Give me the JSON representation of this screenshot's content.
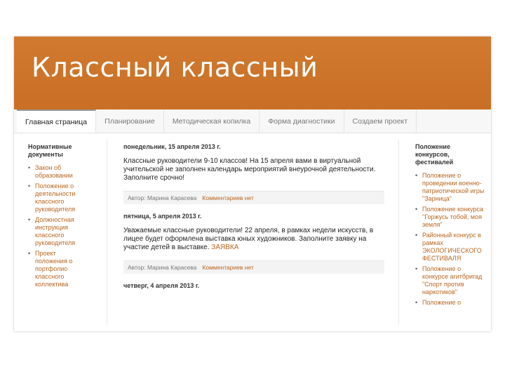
{
  "header": {
    "title": "Классный классный"
  },
  "tabs": [
    {
      "label": "Главная страница",
      "active": true
    },
    {
      "label": "Планирование"
    },
    {
      "label": "Методическая копилка"
    },
    {
      "label": "Форма диагностики"
    },
    {
      "label": "Создаем проект"
    }
  ],
  "left": {
    "heading": "Нормативные документы",
    "items": [
      "Закон об образовании",
      "Положение о деятельности классного руководителя",
      "Должностная инструкция классного руководителя",
      "Проект положения о портфолио классного коллектива"
    ]
  },
  "posts": [
    {
      "date": "понедельник, 15 апреля 2013 г.",
      "body": "Классные руководители 9-10 классов! На 15 апреля вами в виртуальной учительской не заполнен календарь мероприятий внеурочной деятельности. Заполните срочно!",
      "link": "",
      "author": "Автор: Марина Карасева",
      "comments": "Комментариев нет"
    },
    {
      "date": "пятница, 5 апреля 2013 г.",
      "body": "Уважаемые классные руководители! 22 апреля, в рамках недели искусств, в лицее будет оформлена выставка юных художников. Заполните заявку на участие детей в выставке.",
      "link": "ЗАЯВКА",
      "author": "Автор: Марина Карасева",
      "comments": "Комментариев нет"
    },
    {
      "date": "четверг, 4 апреля 2013 г."
    }
  ],
  "right": {
    "heading": "Положение конкурсов, фестивалей",
    "items": [
      "Положение о проведении военно-патриотической игры \"Зарница\"",
      "Положение конкурса \"Горжусь тобой, моя земля\"",
      "Районный конкурс в рамках ЭКОЛОГИЧЕСКОГО ФЕСТИВАЛЯ",
      "Положение о конкурсе агитбригад \"Спорт против наркотиков\"",
      "Положение о"
    ]
  }
}
